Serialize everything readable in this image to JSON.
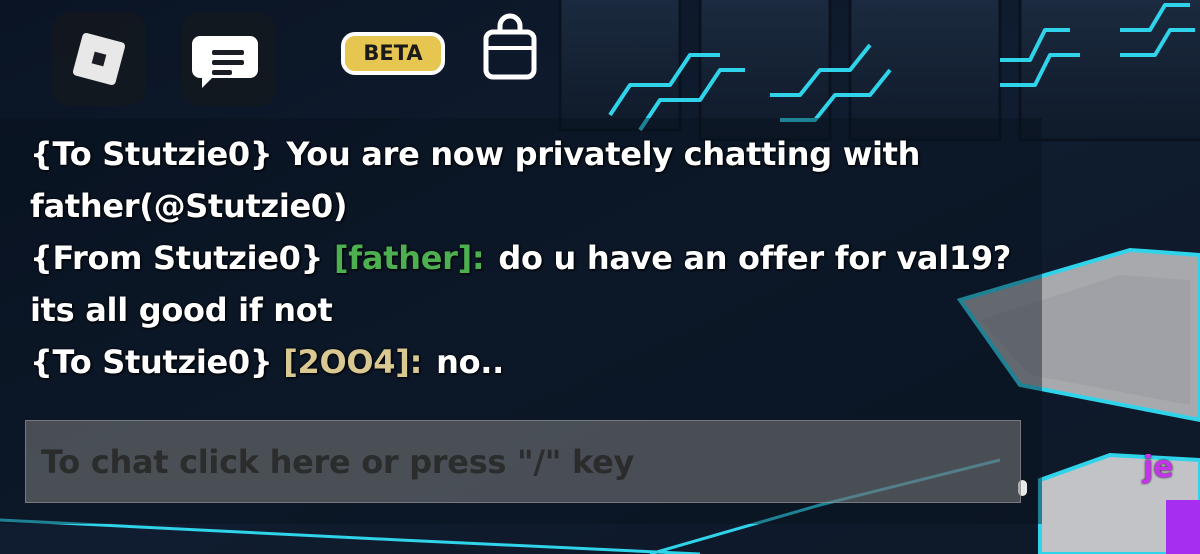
{
  "topbar": {
    "beta_label": "BETA",
    "icons": [
      "roblox-logo-icon",
      "chat-bubble-icon",
      "backpack-icon"
    ]
  },
  "chat": {
    "messages": [
      {
        "prefix": "{To Stutzie0}",
        "sender": "",
        "text": "You are now privately chatting with father(@Stutzie0)"
      },
      {
        "prefix": "{From Stutzie0}",
        "sender": "[father]:",
        "sender_color": "#4caf50",
        "text": "do u have an offer for val19? its all good if not"
      },
      {
        "prefix": "{To Stutzie0}",
        "sender": "[2OO4]:",
        "sender_color": "#d9c891",
        "text": "no.."
      }
    ],
    "input_placeholder": "To chat click here or press \"/\" key"
  },
  "world": {
    "player_name_tag": "je"
  },
  "colors": {
    "beta_badge": "#e6c650",
    "panel_bg": "#08101c",
    "neon_accent": "#2fd4ea",
    "player_tag": "#c235e8"
  }
}
